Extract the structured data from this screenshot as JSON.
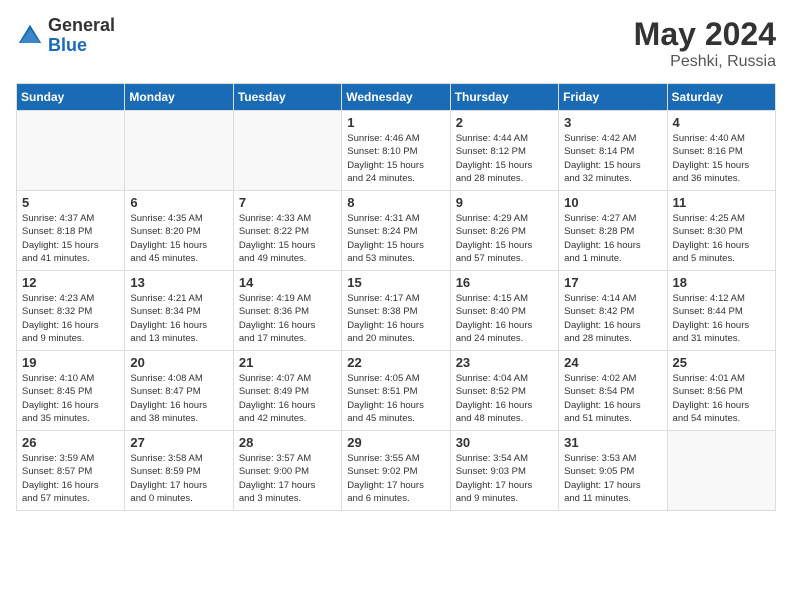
{
  "header": {
    "logo_general": "General",
    "logo_blue": "Blue",
    "month_year": "May 2024",
    "location": "Peshki, Russia"
  },
  "days_of_week": [
    "Sunday",
    "Monday",
    "Tuesday",
    "Wednesday",
    "Thursday",
    "Friday",
    "Saturday"
  ],
  "weeks": [
    [
      {
        "num": "",
        "info": ""
      },
      {
        "num": "",
        "info": ""
      },
      {
        "num": "",
        "info": ""
      },
      {
        "num": "1",
        "info": "Sunrise: 4:46 AM\nSunset: 8:10 PM\nDaylight: 15 hours\nand 24 minutes."
      },
      {
        "num": "2",
        "info": "Sunrise: 4:44 AM\nSunset: 8:12 PM\nDaylight: 15 hours\nand 28 minutes."
      },
      {
        "num": "3",
        "info": "Sunrise: 4:42 AM\nSunset: 8:14 PM\nDaylight: 15 hours\nand 32 minutes."
      },
      {
        "num": "4",
        "info": "Sunrise: 4:40 AM\nSunset: 8:16 PM\nDaylight: 15 hours\nand 36 minutes."
      }
    ],
    [
      {
        "num": "5",
        "info": "Sunrise: 4:37 AM\nSunset: 8:18 PM\nDaylight: 15 hours\nand 41 minutes."
      },
      {
        "num": "6",
        "info": "Sunrise: 4:35 AM\nSunset: 8:20 PM\nDaylight: 15 hours\nand 45 minutes."
      },
      {
        "num": "7",
        "info": "Sunrise: 4:33 AM\nSunset: 8:22 PM\nDaylight: 15 hours\nand 49 minutes."
      },
      {
        "num": "8",
        "info": "Sunrise: 4:31 AM\nSunset: 8:24 PM\nDaylight: 15 hours\nand 53 minutes."
      },
      {
        "num": "9",
        "info": "Sunrise: 4:29 AM\nSunset: 8:26 PM\nDaylight: 15 hours\nand 57 minutes."
      },
      {
        "num": "10",
        "info": "Sunrise: 4:27 AM\nSunset: 8:28 PM\nDaylight: 16 hours\nand 1 minute."
      },
      {
        "num": "11",
        "info": "Sunrise: 4:25 AM\nSunset: 8:30 PM\nDaylight: 16 hours\nand 5 minutes."
      }
    ],
    [
      {
        "num": "12",
        "info": "Sunrise: 4:23 AM\nSunset: 8:32 PM\nDaylight: 16 hours\nand 9 minutes."
      },
      {
        "num": "13",
        "info": "Sunrise: 4:21 AM\nSunset: 8:34 PM\nDaylight: 16 hours\nand 13 minutes."
      },
      {
        "num": "14",
        "info": "Sunrise: 4:19 AM\nSunset: 8:36 PM\nDaylight: 16 hours\nand 17 minutes."
      },
      {
        "num": "15",
        "info": "Sunrise: 4:17 AM\nSunset: 8:38 PM\nDaylight: 16 hours\nand 20 minutes."
      },
      {
        "num": "16",
        "info": "Sunrise: 4:15 AM\nSunset: 8:40 PM\nDaylight: 16 hours\nand 24 minutes."
      },
      {
        "num": "17",
        "info": "Sunrise: 4:14 AM\nSunset: 8:42 PM\nDaylight: 16 hours\nand 28 minutes."
      },
      {
        "num": "18",
        "info": "Sunrise: 4:12 AM\nSunset: 8:44 PM\nDaylight: 16 hours\nand 31 minutes."
      }
    ],
    [
      {
        "num": "19",
        "info": "Sunrise: 4:10 AM\nSunset: 8:45 PM\nDaylight: 16 hours\nand 35 minutes."
      },
      {
        "num": "20",
        "info": "Sunrise: 4:08 AM\nSunset: 8:47 PM\nDaylight: 16 hours\nand 38 minutes."
      },
      {
        "num": "21",
        "info": "Sunrise: 4:07 AM\nSunset: 8:49 PM\nDaylight: 16 hours\nand 42 minutes."
      },
      {
        "num": "22",
        "info": "Sunrise: 4:05 AM\nSunset: 8:51 PM\nDaylight: 16 hours\nand 45 minutes."
      },
      {
        "num": "23",
        "info": "Sunrise: 4:04 AM\nSunset: 8:52 PM\nDaylight: 16 hours\nand 48 minutes."
      },
      {
        "num": "24",
        "info": "Sunrise: 4:02 AM\nSunset: 8:54 PM\nDaylight: 16 hours\nand 51 minutes."
      },
      {
        "num": "25",
        "info": "Sunrise: 4:01 AM\nSunset: 8:56 PM\nDaylight: 16 hours\nand 54 minutes."
      }
    ],
    [
      {
        "num": "26",
        "info": "Sunrise: 3:59 AM\nSunset: 8:57 PM\nDaylight: 16 hours\nand 57 minutes."
      },
      {
        "num": "27",
        "info": "Sunrise: 3:58 AM\nSunset: 8:59 PM\nDaylight: 17 hours\nand 0 minutes."
      },
      {
        "num": "28",
        "info": "Sunrise: 3:57 AM\nSunset: 9:00 PM\nDaylight: 17 hours\nand 3 minutes."
      },
      {
        "num": "29",
        "info": "Sunrise: 3:55 AM\nSunset: 9:02 PM\nDaylight: 17 hours\nand 6 minutes."
      },
      {
        "num": "30",
        "info": "Sunrise: 3:54 AM\nSunset: 9:03 PM\nDaylight: 17 hours\nand 9 minutes."
      },
      {
        "num": "31",
        "info": "Sunrise: 3:53 AM\nSunset: 9:05 PM\nDaylight: 17 hours\nand 11 minutes."
      },
      {
        "num": "",
        "info": ""
      }
    ]
  ]
}
